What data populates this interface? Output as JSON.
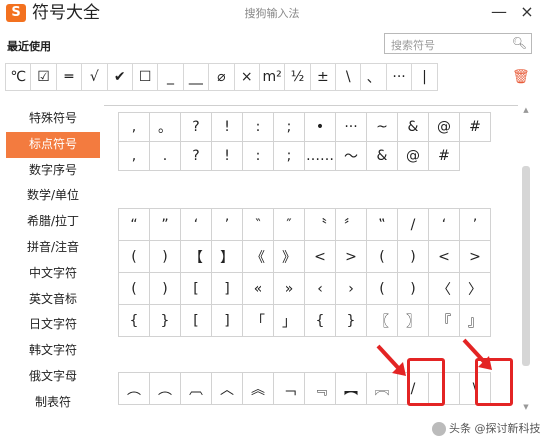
{
  "app": {
    "title": "符号大全",
    "logo_text": "S",
    "ime_name": "搜狗输入法",
    "minimize_glyph": "—",
    "close_glyph": "×"
  },
  "recent": {
    "label": "最近使用",
    "search_placeholder": "搜索符号",
    "symbols": [
      "℃",
      "☑",
      "═",
      "√",
      "✔",
      "☐",
      "_",
      "__",
      "⌀",
      "×",
      "m²",
      "½",
      "±",
      "\\",
      "、",
      "···",
      "|"
    ]
  },
  "sidebar": {
    "items": [
      {
        "label": "特殊符号",
        "active": false
      },
      {
        "label": "标点符号",
        "active": true
      },
      {
        "label": "数字序号",
        "active": false
      },
      {
        "label": "数学/单位",
        "active": false
      },
      {
        "label": "希腊/拉丁",
        "active": false
      },
      {
        "label": "拼音/注音",
        "active": false
      },
      {
        "label": "中文字符",
        "active": false
      },
      {
        "label": "英文音标",
        "active": false
      },
      {
        "label": "日文字符",
        "active": false
      },
      {
        "label": "韩文字符",
        "active": false
      },
      {
        "label": "俄文字母",
        "active": false
      },
      {
        "label": "制表符",
        "active": false
      }
    ]
  },
  "grid": {
    "block1": [
      [
        ",",
        "。",
        "?",
        "!",
        ":",
        ";",
        "•",
        "···",
        "~",
        "&",
        "@",
        "#"
      ],
      [
        ",",
        ".",
        "?",
        "!",
        ":",
        ";",
        "……",
        "～",
        "&",
        "@",
        "#"
      ]
    ],
    "block2": [
      [
        "“",
        "”",
        "‘",
        "’",
        "‶",
        "″",
        "〝",
        "〞",
        "‟",
        "/",
        "‘",
        "’"
      ],
      [
        "(",
        ")",
        "【",
        "】",
        "《",
        "》",
        "<",
        ">",
        "(",
        ")",
        "<",
        ">"
      ],
      [
        "(",
        ")",
        "[",
        "]",
        "«",
        "»",
        "‹",
        "›",
        "(",
        ")",
        "〈",
        "〉"
      ],
      [
        "{",
        "}",
        "[",
        "]",
        "「",
        "」",
        "{",
        "}",
        "〖",
        "〗",
        "『",
        "』"
      ]
    ],
    "block3": [
      [
        "︵",
        "︵",
        "︹",
        "︿",
        "︽",
        "﹁",
        "﹃",
        "︻",
        "︗",
        "/",
        "|",
        "\\"
      ]
    ]
  },
  "watermark": "头条 @探讨新科技",
  "colors": {
    "accent": "#f37b3f",
    "highlight": "#e32424",
    "logo": "#f3711f"
  }
}
